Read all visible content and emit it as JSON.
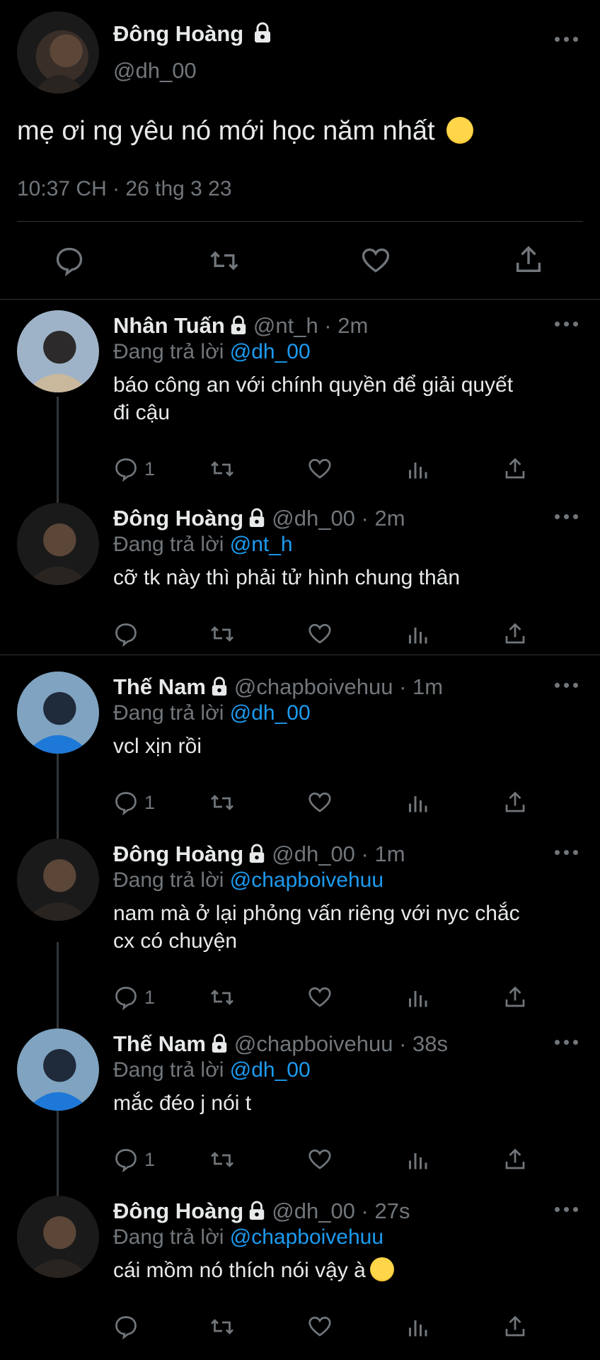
{
  "main_tweet": {
    "name": "Đông Hoàng",
    "handle": "@dh_00",
    "text": "mẹ ơi ng yêu nó mới học năm nhất",
    "emoji": "😱",
    "timestamp": "10:37 CH · 26 thg 3 23"
  },
  "replies": [
    {
      "name": "Nhân Tuấn",
      "handle": "@nt_h",
      "time": "· 2m",
      "replying_prefix": "Đang trả lời",
      "replying_to": "@dh_00",
      "text_lines": [
        "báo công an với chính quyền để giải quyết",
        "đi cậu"
      ],
      "reply_count": "1"
    },
    {
      "name": "Đông Hoàng",
      "handle": "@dh_00",
      "time": "· 2m",
      "replying_prefix": "Đang trả lời",
      "replying_to": "@nt_h",
      "text_lines": [
        "cỡ tk này thì phải tử hình chung thân"
      ],
      "reply_count": ""
    },
    {
      "name": "Thế Nam",
      "handle": "@chapboivehuu",
      "time": "· 1m",
      "replying_prefix": "Đang trả lời",
      "replying_to": "@dh_00",
      "text_lines": [
        "vcl xịn rồi"
      ],
      "reply_count": "1"
    },
    {
      "name": "Đông Hoàng",
      "handle": "@dh_00",
      "time": "· 1m",
      "replying_prefix": "Đang trả lời",
      "replying_to": "@chapboivehuu",
      "text_lines": [
        "nam mà ở lại phỏng vấn riêng với nyc chắc",
        "cx có chuyện"
      ],
      "reply_count": "1"
    },
    {
      "name": "Thế Nam",
      "handle": "@chapboivehuu",
      "time": "· 38s",
      "replying_prefix": "Đang trả lời",
      "replying_to": "@dh_00",
      "text_lines": [
        "mắc đéo j nói t"
      ],
      "reply_count": "1"
    },
    {
      "name": "Đông Hoàng",
      "handle": "@dh_00",
      "time": "· 27s",
      "replying_prefix": "Đang trả lời",
      "replying_to": "@chapboivehuu",
      "text_lines": [
        "cái mồm nó thích nói vậy à"
      ],
      "emoji": "🤗",
      "reply_count": ""
    }
  ],
  "icons": {
    "reply": "reply-icon",
    "retweet": "retweet-icon",
    "like": "heart-icon",
    "views": "views-icon",
    "share": "share-icon",
    "lock": "lock-icon",
    "more": "more-icon"
  },
  "colors": {
    "background": "#000000",
    "text": "#e7e9ea",
    "muted": "#71767b",
    "mention": "#1d9bf0"
  }
}
